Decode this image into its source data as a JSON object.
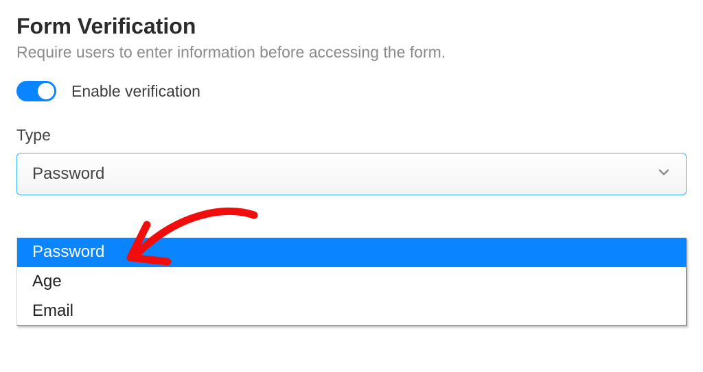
{
  "heading": "Form Verification",
  "subheading": "Require users to enter information before accessing the form.",
  "toggle": {
    "label": "Enable verification",
    "on": true
  },
  "type_field": {
    "label": "Type",
    "selected": "Password",
    "options": [
      "Password",
      "Age",
      "Email"
    ]
  },
  "colors": {
    "accent": "#0a84ff",
    "annotation": "#f20d0d"
  }
}
